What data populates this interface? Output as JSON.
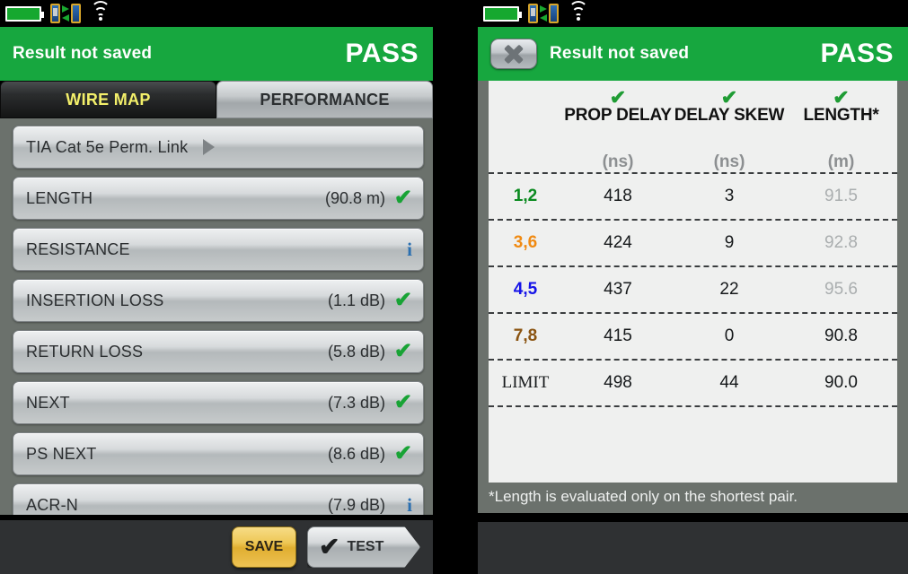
{
  "colors": {
    "pass_green": "#17a73f",
    "accent_yellow": "#f3ef6a",
    "save_amber": "#eec857",
    "pair_1_2": "#0a8a1f",
    "pair_3_6": "#f08a12",
    "pair_4_5": "#1513e8",
    "pair_7_8": "#8a5310",
    "panel_gray": "#6b716c",
    "table_bg": "#eff0ef"
  },
  "statusbar": {
    "battery_icon": "battery-full-icon",
    "transfer_icon": "unit-transfer-icon",
    "wifi_icon": "wifi-icon"
  },
  "left": {
    "header": {
      "title": "Result not saved",
      "verdict": "PASS"
    },
    "tabs": [
      {
        "label": "WIRE MAP",
        "active": true
      },
      {
        "label": "PERFORMANCE",
        "active": false
      }
    ],
    "standard": {
      "label": "TIA Cat 5e Perm. Link",
      "chevron_icon": "chevron-right-icon"
    },
    "results": [
      {
        "label": "LENGTH",
        "value": "(90.8 m)",
        "status": "pass"
      },
      {
        "label": "RESISTANCE",
        "value": "",
        "status": "info"
      },
      {
        "label": "INSERTION LOSS",
        "value": "(1.1 dB)",
        "status": "pass"
      },
      {
        "label": "RETURN LOSS",
        "value": "(5.8 dB)",
        "status": "pass"
      },
      {
        "label": "NEXT",
        "value": "(7.3 dB)",
        "status": "pass"
      },
      {
        "label": "PS NEXT",
        "value": "(8.6 dB)",
        "status": "pass"
      },
      {
        "label": "ACR-N",
        "value": "(7.9 dB)",
        "status": "info"
      }
    ],
    "toolbar": {
      "save_label": "SAVE",
      "test_label": "TEST",
      "test_icon": "checkmark-icon"
    }
  },
  "right": {
    "header": {
      "title": "Result not saved",
      "verdict": "PASS",
      "close_icon": "close-x-icon"
    },
    "table": {
      "columns": [
        {
          "name": "",
          "unit": "",
          "status": ""
        },
        {
          "name": "PROP DELAY",
          "unit": "(ns)",
          "status": "pass"
        },
        {
          "name": "DELAY SKEW",
          "unit": "(ns)",
          "status": "pass"
        },
        {
          "name": "LENGTH*",
          "unit": "(m)",
          "status": "pass"
        }
      ],
      "rows": [
        {
          "pair": "1,2",
          "color": "#0a8a1f",
          "prop_delay": "418",
          "delay_skew": "3",
          "length": "91.5",
          "length_muted": true
        },
        {
          "pair": "3,6",
          "color": "#f08a12",
          "prop_delay": "424",
          "delay_skew": "9",
          "length": "92.8",
          "length_muted": true
        },
        {
          "pair": "4,5",
          "color": "#1513e8",
          "prop_delay": "437",
          "delay_skew": "22",
          "length": "95.6",
          "length_muted": true
        },
        {
          "pair": "7,8",
          "color": "#8a5310",
          "prop_delay": "415",
          "delay_skew": "0",
          "length": "90.8",
          "length_muted": false
        },
        {
          "pair": "LIMIT",
          "color": "#15181a",
          "prop_delay": "498",
          "delay_skew": "44",
          "length": "90.0",
          "length_muted": false
        }
      ]
    },
    "footnote": "*Length is evaluated only on the shortest pair."
  }
}
